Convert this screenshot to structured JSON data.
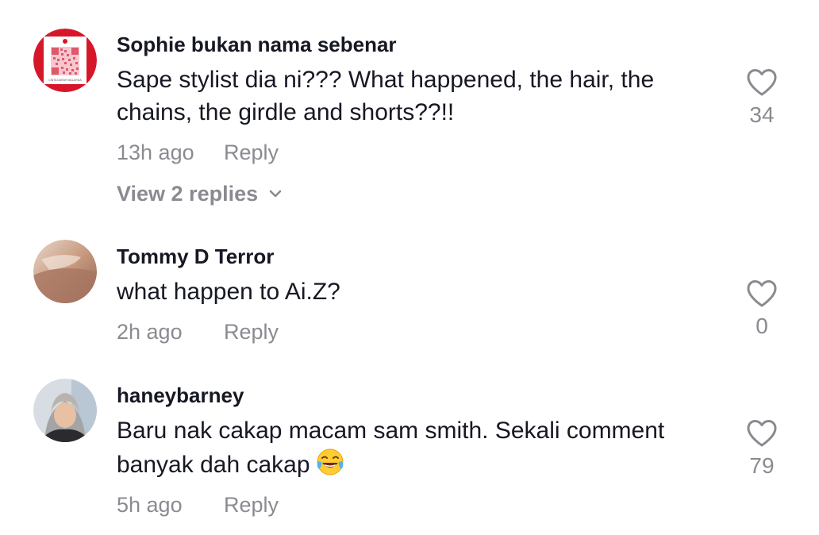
{
  "comments": [
    {
      "username": "Sophie bukan nama sebenar",
      "text": "Sape stylist dia ni??? What happened, the hair, the chains, the girdle and shorts??!!",
      "time": "13h ago",
      "reply_label": "Reply",
      "likes": "34",
      "view_replies": "View 2 replies",
      "avatar_icon": "qr-code-avatar",
      "avatar_caption": "CINTA DARAH MALAYSIA"
    },
    {
      "username": "Tommy D Terror",
      "text": "what happen to Ai.Z?",
      "time": "2h ago",
      "reply_label": "Reply",
      "likes": "0",
      "avatar_icon": "photo-avatar"
    },
    {
      "username": "haneybarney",
      "text": "Baru nak cakap macam sam smith. Sekali comment banyak dah cakap",
      "emoji": "face-with-tears-of-joy",
      "time": "5h ago",
      "reply_label": "Reply",
      "likes": "79",
      "avatar_icon": "photo-avatar"
    }
  ],
  "colors": {
    "primary_text": "#161823",
    "secondary_text": "#8a8b91",
    "qr_red": "#d6172a"
  }
}
